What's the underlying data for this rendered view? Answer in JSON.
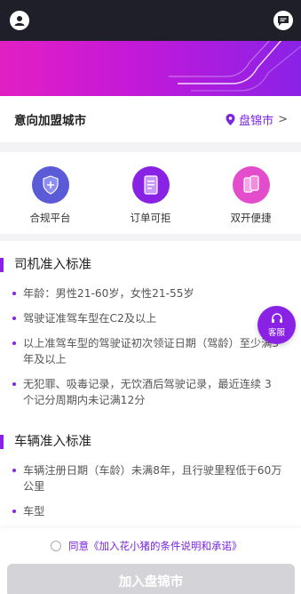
{
  "city_row": {
    "label": "意向加盟城市",
    "value": "盘锦市",
    "chevron": ">"
  },
  "features": [
    {
      "label": "合规平台",
      "icon": "shield-icon",
      "color": "#5b5bd8"
    },
    {
      "label": "订单可拒",
      "icon": "document-icon",
      "color": "#8a22e6"
    },
    {
      "label": "双开便捷",
      "icon": "phones-icon",
      "color": "#e34ccb"
    }
  ],
  "driver_section": {
    "title": "司机准入标准",
    "items": [
      "年龄：男性21-60岁，女性21-55岁",
      "驾驶证准驾车型在C2及以上",
      "以上准驾车型的驾驶证初次领证日期（驾龄）至少满3年及以上",
      "无犯罪、吸毒记录，无饮酒后驾驶记录，最近连续 3 个记分周期内未记满12分"
    ]
  },
  "vehicle_section": {
    "title": "车辆准入标准",
    "items": [
      "车辆注册日期（车龄）未满8年，且行驶里程低于60万公里",
      "车型"
    ]
  },
  "service_button": {
    "label": "客服"
  },
  "agreement": {
    "text": "同意《加入花小猪的条件说明和承诺》"
  },
  "join_button": {
    "label": "加入盘锦市"
  },
  "colors": {
    "accent": "#8a22e6",
    "header": "#1f1f2a"
  }
}
